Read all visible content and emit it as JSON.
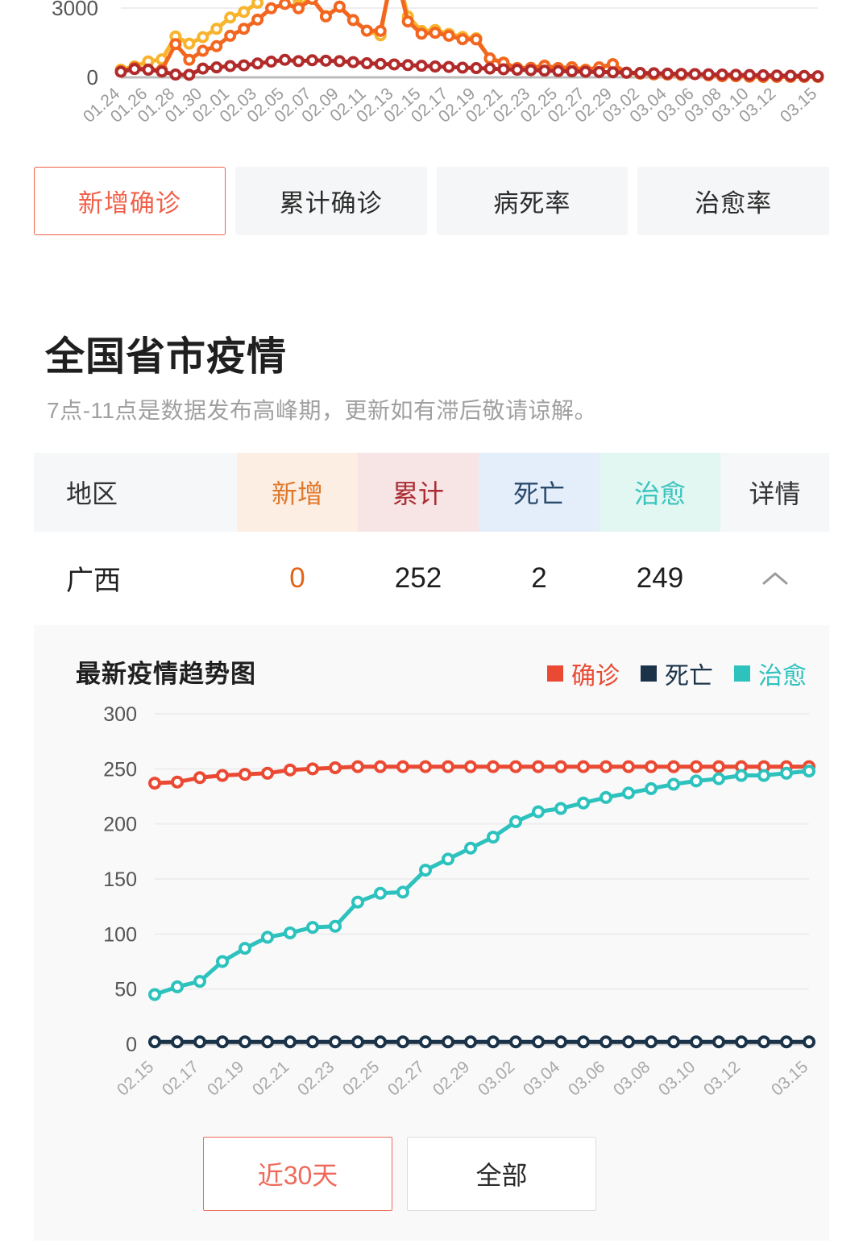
{
  "national_chart": {
    "y_axis_labels": [
      "3000",
      "0"
    ],
    "x_axis_labels": [
      "01.24",
      "01.26",
      "01.28",
      "01.30",
      "02.01",
      "02.03",
      "02.05",
      "02.07",
      "02.09",
      "02.11",
      "02.13",
      "02.15",
      "02.17",
      "02.19",
      "02.21",
      "02.23",
      "02.25",
      "02.27",
      "02.29",
      "03.02",
      "03.04",
      "03.06",
      "03.08",
      "03.10",
      "03.12",
      "03.15"
    ]
  },
  "metric_tabs": [
    {
      "label": "新增确诊",
      "active": true
    },
    {
      "label": "累计确诊",
      "active": false
    },
    {
      "label": "病死率",
      "active": false
    },
    {
      "label": "治愈率",
      "active": false
    }
  ],
  "section": {
    "title": "全国省市疫情",
    "subtitle": "7点-11点是数据发布高峰期，更新如有滞后敬请谅解。"
  },
  "table": {
    "headers": [
      "地区",
      "新增",
      "累计",
      "死亡",
      "治愈",
      "详情"
    ],
    "rows": [
      {
        "region": "广西",
        "new": "0",
        "total": "252",
        "death": "2",
        "cured": "249",
        "expand_icon": "chevron-up-icon"
      }
    ]
  },
  "detail_panel": {
    "title": "最新疫情趋势图",
    "legend": [
      {
        "label": "确诊",
        "color": "#ea4a33"
      },
      {
        "label": "死亡",
        "color": "#1b3349"
      },
      {
        "label": "治愈",
        "color": "#2dc2bd"
      }
    ],
    "range_buttons": [
      {
        "label": "近30天",
        "active": true
      },
      {
        "label": "全部",
        "active": false
      }
    ]
  },
  "chart_data": {
    "type": "line",
    "title": "最新疫情趋势图",
    "xlabel": "",
    "ylabel": "",
    "ylim": [
      0,
      300
    ],
    "yticks": [
      0,
      50,
      100,
      150,
      200,
      250,
      300
    ],
    "grid": true,
    "legend_position": "top-right",
    "x": [
      "02.15",
      "02.16",
      "02.17",
      "02.18",
      "02.19",
      "02.20",
      "02.21",
      "02.22",
      "02.23",
      "02.24",
      "02.25",
      "02.26",
      "02.27",
      "02.28",
      "02.29",
      "03.01",
      "03.02",
      "03.03",
      "03.04",
      "03.05",
      "03.06",
      "03.07",
      "03.08",
      "03.09",
      "03.10",
      "03.11",
      "03.12",
      "03.13",
      "03.14",
      "03.15"
    ],
    "series": [
      {
        "name": "确诊",
        "color": "#ea4a33",
        "values": [
          237,
          238,
          242,
          244,
          245,
          246,
          249,
          250,
          251,
          252,
          252,
          252,
          252,
          252,
          252,
          252,
          252,
          252,
          252,
          252,
          252,
          252,
          252,
          252,
          252,
          252,
          252,
          252,
          252,
          252
        ]
      },
      {
        "name": "死亡",
        "color": "#1b3349",
        "values": [
          2,
          2,
          2,
          2,
          2,
          2,
          2,
          2,
          2,
          2,
          2,
          2,
          2,
          2,
          2,
          2,
          2,
          2,
          2,
          2,
          2,
          2,
          2,
          2,
          2,
          2,
          2,
          2,
          2,
          2
        ]
      },
      {
        "name": "治愈",
        "color": "#2dc2bd",
        "values": [
          45,
          52,
          57,
          75,
          87,
          97,
          101,
          106,
          107,
          129,
          137,
          138,
          158,
          168,
          178,
          188,
          202,
          211,
          214,
          219,
          224,
          228,
          232,
          236,
          239,
          241,
          244,
          244,
          246,
          248
        ]
      }
    ]
  },
  "national_chart_data": {
    "type": "line",
    "title": "",
    "ylim": [
      0,
      4200
    ],
    "yticks": [
      0,
      3000
    ],
    "grid": true,
    "x": [
      "01.24",
      "01.25",
      "01.26",
      "01.27",
      "01.28",
      "01.29",
      "01.30",
      "01.31",
      "02.01",
      "02.02",
      "02.03",
      "02.04",
      "02.05",
      "02.06",
      "02.07",
      "02.08",
      "02.09",
      "02.10",
      "02.11",
      "02.12",
      "02.13",
      "02.14",
      "02.15",
      "02.16",
      "02.17",
      "02.18",
      "02.19",
      "02.20",
      "02.21",
      "02.22",
      "02.23",
      "02.24",
      "02.25",
      "02.26",
      "02.27",
      "02.28",
      "02.29",
      "03.01",
      "03.02",
      "03.03",
      "03.04",
      "03.05",
      "03.06",
      "03.07",
      "03.08",
      "03.09",
      "03.10",
      "03.11",
      "03.12",
      "03.13",
      "03.14",
      "03.15"
    ],
    "series": [
      {
        "name": "series-amber",
        "color": "#f7b42c",
        "values": [
          330,
          470,
          690,
          780,
          1770,
          1460,
          1740,
          2100,
          2590,
          2830,
          3230,
          3890,
          3900,
          3140,
          3400,
          2650,
          3060,
          2480,
          2020,
          1820,
          5090,
          2640,
          2010,
          2050,
          1880,
          1750,
          1690,
          820,
          640,
          400,
          410,
          510,
          400,
          440,
          330,
          430,
          570,
          200,
          160,
          130,
          120,
          110,
          140,
          90,
          50,
          50,
          30,
          20,
          20,
          20,
          20,
          20
        ]
      },
      {
        "name": "series-orange",
        "color": "#f2661f",
        "values": [
          260,
          420,
          340,
          320,
          1440,
          760,
          1150,
          1350,
          1800,
          2100,
          2500,
          2990,
          3180,
          2990,
          3400,
          2640,
          3060,
          2480,
          2020,
          2010,
          4820,
          2420,
          1890,
          1930,
          1800,
          1650,
          1640,
          820,
          630,
          400,
          410,
          500,
          400,
          430,
          320,
          430,
          570,
          200,
          160,
          130,
          120,
          110,
          140,
          90,
          50,
          50,
          30,
          20,
          20,
          20,
          20,
          20
        ]
      },
      {
        "name": "series-darkred",
        "color": "#b22b2b",
        "values": [
          240,
          360,
          330,
          250,
          120,
          110,
          380,
          430,
          490,
          520,
          600,
          680,
          760,
          700,
          740,
          720,
          700,
          660,
          610,
          580,
          560,
          530,
          500,
          470,
          450,
          420,
          400,
          380,
          350,
          330,
          310,
          290,
          270,
          260,
          240,
          230,
          220,
          200,
          190,
          180,
          160,
          150,
          140,
          130,
          120,
          110,
          100,
          90,
          80,
          70,
          60,
          50
        ]
      }
    ]
  }
}
